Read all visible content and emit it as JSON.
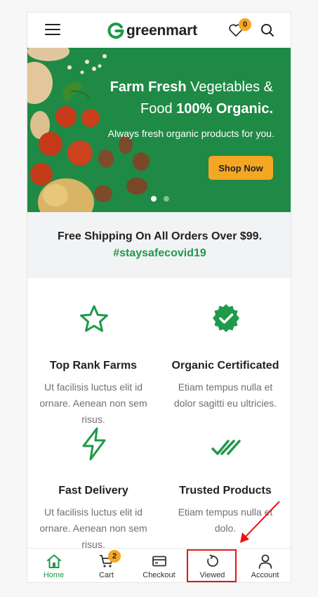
{
  "header": {
    "logo_text": "greenmart",
    "wishlist_count": "0",
    "icons": [
      "menu-icon",
      "heart-icon",
      "search-icon"
    ]
  },
  "hero": {
    "title_bold_1": "Farm Fresh",
    "title_regular_1": " Vegetables &",
    "title_regular_2": "Food ",
    "title_bold_2": "100% Organic.",
    "subtitle": "Always fresh organic products for you.",
    "cta_label": "Shop Now",
    "slide_count": 2,
    "active_slide": 1
  },
  "shipping": {
    "line": "Free Shipping On All Orders Over $99.",
    "tag": "#staysafecovid19"
  },
  "features": [
    {
      "icon": "star-icon",
      "title": "Top Rank Farms",
      "desc": "Ut facilisis luctus elit id ornare. Aenean non sem risus."
    },
    {
      "icon": "certified-badge-icon",
      "title": "Organic Certificated",
      "desc": "Etiam tempus nulla et dolor sagitti eu ultricies."
    },
    {
      "icon": "lightning-icon",
      "title": "Fast Delivery",
      "desc": "Ut facilisis luctus elit id ornare. Aenean non sem risus."
    },
    {
      "icon": "double-check-icon",
      "title": "Trusted Products",
      "desc": "Etiam tempus nulla et dolo."
    }
  ],
  "bottom_nav": {
    "items": [
      {
        "label": "Home",
        "icon": "home-icon",
        "active": true
      },
      {
        "label": "Cart",
        "icon": "cart-icon",
        "badge": "2"
      },
      {
        "label": "Checkout",
        "icon": "checkout-card-icon"
      },
      {
        "label": "Viewed",
        "icon": "history-icon"
      },
      {
        "label": "Account",
        "icon": "user-icon"
      }
    ]
  },
  "colors": {
    "brand_green": "#1e9a4b",
    "hero_green": "#1f8a45",
    "accent_orange": "#f5a623",
    "annotation_red": "#e11111"
  }
}
